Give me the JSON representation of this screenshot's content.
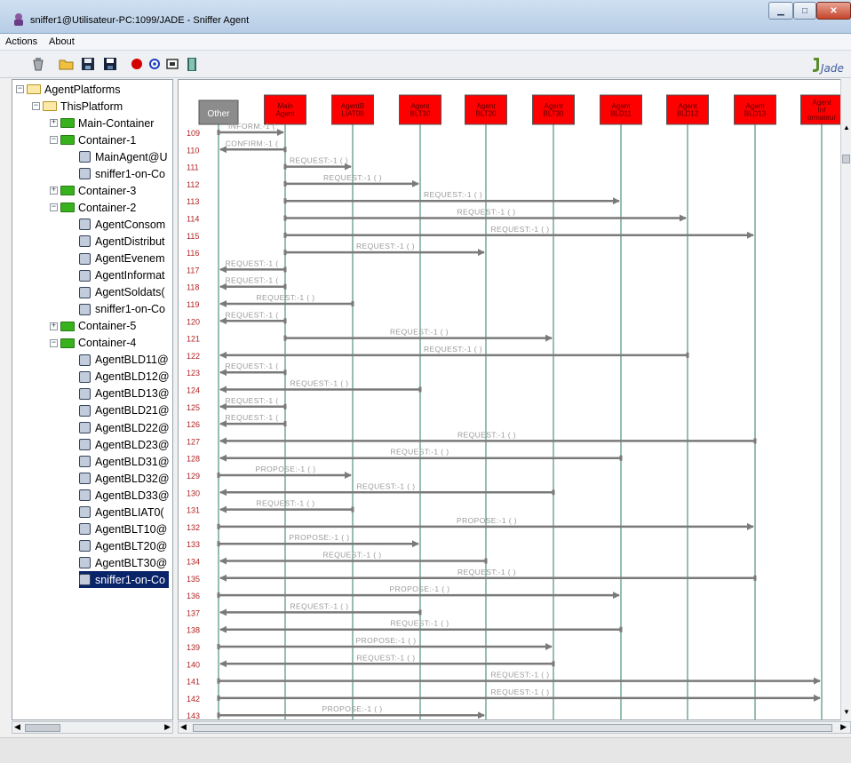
{
  "window": {
    "title": "sniffer1@Utilisateur-PC:1099/JADE - Sniffer Agent",
    "minimize_label": "▁",
    "maximize_label": "□",
    "close_label": "✕"
  },
  "menu": {
    "items": [
      "Actions",
      "About"
    ]
  },
  "toolbar": {
    "buttons": [
      "clear-canvas-icon",
      "open-icon",
      "save-tree-icon",
      "save-icon",
      "record-icon",
      "filter-icon",
      "display-icon",
      "exit-door-icon"
    ],
    "logo": "Jade"
  },
  "tree": {
    "nodes": [
      {
        "label": "AgentPlatforms",
        "level": 0,
        "kind": "folder",
        "expander": "−"
      },
      {
        "label": "ThisPlatform",
        "level": 1,
        "kind": "folder",
        "expander": "−"
      },
      {
        "label": "Main-Container",
        "level": 2,
        "kind": "folder",
        "expander": "+"
      },
      {
        "label": "Container-1",
        "level": 2,
        "kind": "folder",
        "expander": "−"
      },
      {
        "label": "MainAgent@U",
        "level": 3,
        "kind": "agent"
      },
      {
        "label": "sniffer1-on-Co",
        "level": 3,
        "kind": "agent"
      },
      {
        "label": "Container-3",
        "level": 2,
        "kind": "folder",
        "expander": "+"
      },
      {
        "label": "Container-2",
        "level": 2,
        "kind": "folder",
        "expander": "−"
      },
      {
        "label": "AgentConsom",
        "level": 3,
        "kind": "agent"
      },
      {
        "label": "AgentDistribut",
        "level": 3,
        "kind": "agent"
      },
      {
        "label": "AgentEvenem",
        "level": 3,
        "kind": "agent"
      },
      {
        "label": "AgentInformat",
        "level": 3,
        "kind": "agent"
      },
      {
        "label": "AgentSoldats(",
        "level": 3,
        "kind": "agent"
      },
      {
        "label": "sniffer1-on-Co",
        "level": 3,
        "kind": "agent"
      },
      {
        "label": "Container-5",
        "level": 2,
        "kind": "folder",
        "expander": "+"
      },
      {
        "label": "Container-4",
        "level": 2,
        "kind": "folder",
        "expander": "−"
      },
      {
        "label": "AgentBLD11@",
        "level": 3,
        "kind": "agent"
      },
      {
        "label": "AgentBLD12@",
        "level": 3,
        "kind": "agent"
      },
      {
        "label": "AgentBLD13@",
        "level": 3,
        "kind": "agent"
      },
      {
        "label": "AgentBLD21@",
        "level": 3,
        "kind": "agent"
      },
      {
        "label": "AgentBLD22@",
        "level": 3,
        "kind": "agent"
      },
      {
        "label": "AgentBLD23@",
        "level": 3,
        "kind": "agent"
      },
      {
        "label": "AgentBLD31@",
        "level": 3,
        "kind": "agent"
      },
      {
        "label": "AgentBLD32@",
        "level": 3,
        "kind": "agent"
      },
      {
        "label": "AgentBLD33@",
        "level": 3,
        "kind": "agent"
      },
      {
        "label": "AgentBLIAT0(",
        "level": 3,
        "kind": "agent"
      },
      {
        "label": "AgentBLT10@",
        "level": 3,
        "kind": "agent"
      },
      {
        "label": "AgentBLT20@",
        "level": 3,
        "kind": "agent"
      },
      {
        "label": "AgentBLT30@",
        "level": 3,
        "kind": "agent"
      },
      {
        "label": "sniffer1-on-Co",
        "level": 3,
        "kind": "agent",
        "selected": true
      }
    ]
  },
  "diagram": {
    "agents": [
      "Other",
      "Main\nAgent",
      "AgentB\nLIAT00",
      "Agent\nBLT10",
      "Agent\nBLT20",
      "Agent\nBLT30",
      "Agent\nBLD11",
      "Agent\nBLD12",
      "Agent\nBLD13",
      "Agent\nInf\normateur"
    ],
    "messages": [
      {
        "n": 109,
        "from": 0,
        "to": 1,
        "label": "INFORM:-1 ("
      },
      {
        "n": 110,
        "from": 1,
        "to": 0,
        "label": "CONFIRM:-1 ("
      },
      {
        "n": 111,
        "from": 1,
        "to": 2,
        "label": "REQUEST:-1 (      )"
      },
      {
        "n": 112,
        "from": 1,
        "to": 3,
        "label": "REQUEST:-1 (      )"
      },
      {
        "n": 113,
        "from": 1,
        "to": 6,
        "label": "REQUEST:-1 (      )"
      },
      {
        "n": 114,
        "from": 1,
        "to": 7,
        "label": "REQUEST:-1 (      )"
      },
      {
        "n": 115,
        "from": 1,
        "to": 8,
        "label": "REQUEST:-1 (      )"
      },
      {
        "n": 116,
        "from": 1,
        "to": 4,
        "label": "REQUEST:-1 (      )"
      },
      {
        "n": 117,
        "from": 1,
        "to": 0,
        "label": "REQUEST:-1 ("
      },
      {
        "n": 118,
        "from": 1,
        "to": 0,
        "label": "REQUEST:-1 ("
      },
      {
        "n": 119,
        "from": 2,
        "to": 0,
        "label": "REQUEST:-1 (      )"
      },
      {
        "n": 120,
        "from": 1,
        "to": 0,
        "label": "REQUEST:-1 ("
      },
      {
        "n": 121,
        "from": 1,
        "to": 5,
        "label": "REQUEST:-1 (      )"
      },
      {
        "n": 122,
        "from": 7,
        "to": 0,
        "label": "REQUEST:-1 (      )"
      },
      {
        "n": 123,
        "from": 1,
        "to": 0,
        "label": "REQUEST:-1 ("
      },
      {
        "n": 124,
        "from": 3,
        "to": 0,
        "label": "REQUEST:-1 (      )"
      },
      {
        "n": 125,
        "from": 1,
        "to": 0,
        "label": "REQUEST:-1 ("
      },
      {
        "n": 126,
        "from": 1,
        "to": 0,
        "label": "REQUEST:-1 ("
      },
      {
        "n": 127,
        "from": 8,
        "to": 0,
        "label": "REQUEST:-1 (      )"
      },
      {
        "n": 128,
        "from": 6,
        "to": 0,
        "label": "REQUEST:-1 (      )"
      },
      {
        "n": 129,
        "from": 0,
        "to": 2,
        "label": "PROPOSE:-1 (      )"
      },
      {
        "n": 130,
        "from": 5,
        "to": 0,
        "label": "REQUEST:-1 (      )"
      },
      {
        "n": 131,
        "from": 2,
        "to": 0,
        "label": "REQUEST:-1 (      )"
      },
      {
        "n": 132,
        "from": 0,
        "to": 8,
        "label": "PROPOSE:-1 (      )"
      },
      {
        "n": 133,
        "from": 0,
        "to": 3,
        "label": "PROPOSE:-1 (      )"
      },
      {
        "n": 134,
        "from": 4,
        "to": 0,
        "label": "REQUEST:-1 (      )"
      },
      {
        "n": 135,
        "from": 8,
        "to": 0,
        "label": "REQUEST:-1 (      )"
      },
      {
        "n": 136,
        "from": 0,
        "to": 6,
        "label": "PROPOSE:-1 (      )"
      },
      {
        "n": 137,
        "from": 3,
        "to": 0,
        "label": "REQUEST:-1 (      )"
      },
      {
        "n": 138,
        "from": 6,
        "to": 0,
        "label": "REQUEST:-1 (      )"
      },
      {
        "n": 139,
        "from": 0,
        "to": 5,
        "label": "PROPOSE:-1 (      )"
      },
      {
        "n": 140,
        "from": 5,
        "to": 0,
        "label": "REQUEST:-1 (      )"
      },
      {
        "n": 141,
        "from": 0,
        "to": 9,
        "label": "REQUEST:-1 (      )"
      },
      {
        "n": 142,
        "from": 0,
        "to": 9,
        "label": "REQUEST:-1 (      )"
      },
      {
        "n": 143,
        "from": 0,
        "to": 4,
        "label": "PROPOSE:-1 (      )"
      }
    ],
    "colors": {
      "agent_box": "#ff0000",
      "other_box": "#8c8c8c",
      "lifeline": "#2e7d5b",
      "arrow": "#7a7a7a",
      "row_number": "#b22222",
      "label": "#9a9a9a"
    }
  }
}
